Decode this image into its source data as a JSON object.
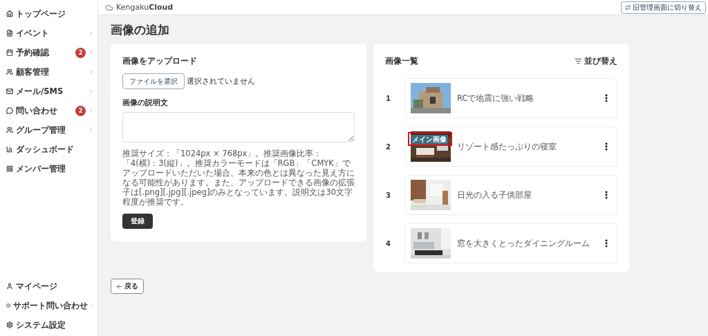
{
  "sidebar": {
    "items": [
      {
        "label": "トップページ",
        "expandable": false
      },
      {
        "label": "イベント",
        "expandable": true
      },
      {
        "label": "予約確認",
        "badge": "2",
        "expandable": true
      },
      {
        "label": "顧客管理",
        "expandable": true
      },
      {
        "label": "メール/SMS",
        "expandable": true
      },
      {
        "label": "問い合わせ",
        "badge": "2",
        "expandable": true
      },
      {
        "label": "グループ管理",
        "expandable": true
      },
      {
        "label": "ダッシュボード",
        "expandable": false
      },
      {
        "label": "メンバー管理",
        "expandable": false
      }
    ],
    "bottom_items": [
      {
        "label": "マイページ",
        "expandable": false
      },
      {
        "label": "サポート問い合わせ",
        "expandable": true
      },
      {
        "label": "システム設定",
        "expandable": false
      }
    ]
  },
  "header": {
    "logo": "Kengaku**Cloud**",
    "switch_button": "旧管理画面に切り替え"
  },
  "page_title": "画像の追加",
  "upload": {
    "title": "画像をアップロード",
    "file_button": "ファイルを選択",
    "file_status": "選択されていません",
    "description_label": "画像の説明文",
    "note": "推奨サイズ：「1024px × 768px」。推奨画像比率：「4(横)：3(縦)」。推奨カラーモードは「RGB」「CMYK」でアップロードいただいた場合、本来の色とは異なった見え方になる可能性があります。また、アップロードできる画像の拡張子は[.png][.jpg][.jpeg]のみとなっています。説明文は30文字程度が推奨です。",
    "submit": "登録"
  },
  "image_list": {
    "title": "画像一覧",
    "sort_button": "並び替え",
    "items": [
      {
        "number": "1",
        "caption": "RCで地震に強い戦略",
        "highlighted": false
      },
      {
        "number": "2",
        "caption": "リゾート感たっぷりの寝室",
        "badge": "メイン画像",
        "highlighted": true
      },
      {
        "number": "3",
        "caption": "日光の入る子供部屋",
        "highlighted": false
      },
      {
        "number": "4",
        "caption": "窓を大きくとったダイニングルーム",
        "highlighted": false
      }
    ]
  },
  "back_button": "戻る"
}
